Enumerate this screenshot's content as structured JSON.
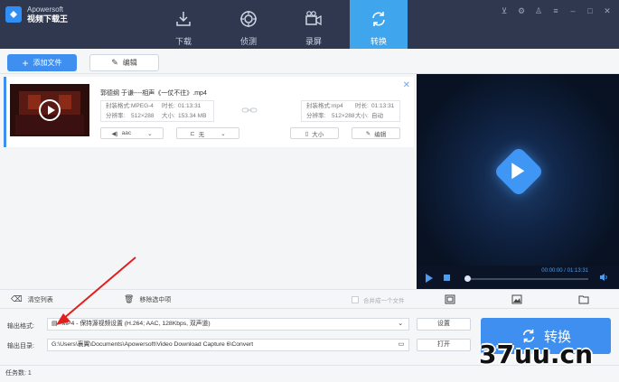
{
  "app": {
    "brand_name": "Apowersoft",
    "brand_sub": "视频下载王"
  },
  "nav": [
    {
      "label": "下载",
      "icon": "download-icon"
    },
    {
      "label": "侦测",
      "icon": "detect-icon"
    },
    {
      "label": "录屏",
      "icon": "record-icon"
    },
    {
      "label": "转换",
      "icon": "convert-icon",
      "active": true
    }
  ],
  "window_controls": [
    "cart-icon",
    "settings-icon",
    "user-icon",
    "menu-icon",
    "minimize-icon",
    "maximize-icon",
    "close-icon"
  ],
  "toolbar": {
    "add_file": "添加文件",
    "edit": "编辑"
  },
  "file": {
    "name": "郭德纲 于谦----相声《一仗不往》.mp4",
    "source": {
      "format_label": "封装格式:",
      "format": "MPEG-4",
      "duration_label": "时长:",
      "duration": "01:13:31",
      "res_label": "分辨率:",
      "res": "512×288",
      "size_label": "大小:",
      "size": "153.34 MB"
    },
    "target": {
      "format_label": "封装格式:",
      "format": "mp4",
      "duration_label": "时长:",
      "duration": "01:13:31",
      "res_label": "分辨率:",
      "res": "512×288",
      "size_label": "大小:",
      "size": "自动"
    },
    "audio": "aac",
    "subtitle": "无",
    "size_btn": "大小",
    "edit_btn": "编辑"
  },
  "player": {
    "time": "00:00:00 / 01:13:31"
  },
  "listbar": {
    "clear": "清空列表",
    "remove": "移除选中项",
    "merge": "合并成一个文件"
  },
  "settings": {
    "format_label": "输出格式:",
    "format_value": "MP4 - 保持源视频设置 (H.264; AAC, 128Kbps, 双声道)",
    "dir_label": "输出目录:",
    "dir_value": "G:\\Users\\襄翼\\Documents\\Apowersoft\\Video Download Capture 6\\Convert",
    "settings_btn": "设置",
    "open_btn": "打开",
    "convert_btn": "转换"
  },
  "status": {
    "tasks": "任务数: 1"
  },
  "watermark": "37uu.cn",
  "colors": {
    "accent": "#3e8ff0",
    "titlebar": "#30384f",
    "active_tab": "#3fa6ee",
    "arrow": "#e02020"
  }
}
